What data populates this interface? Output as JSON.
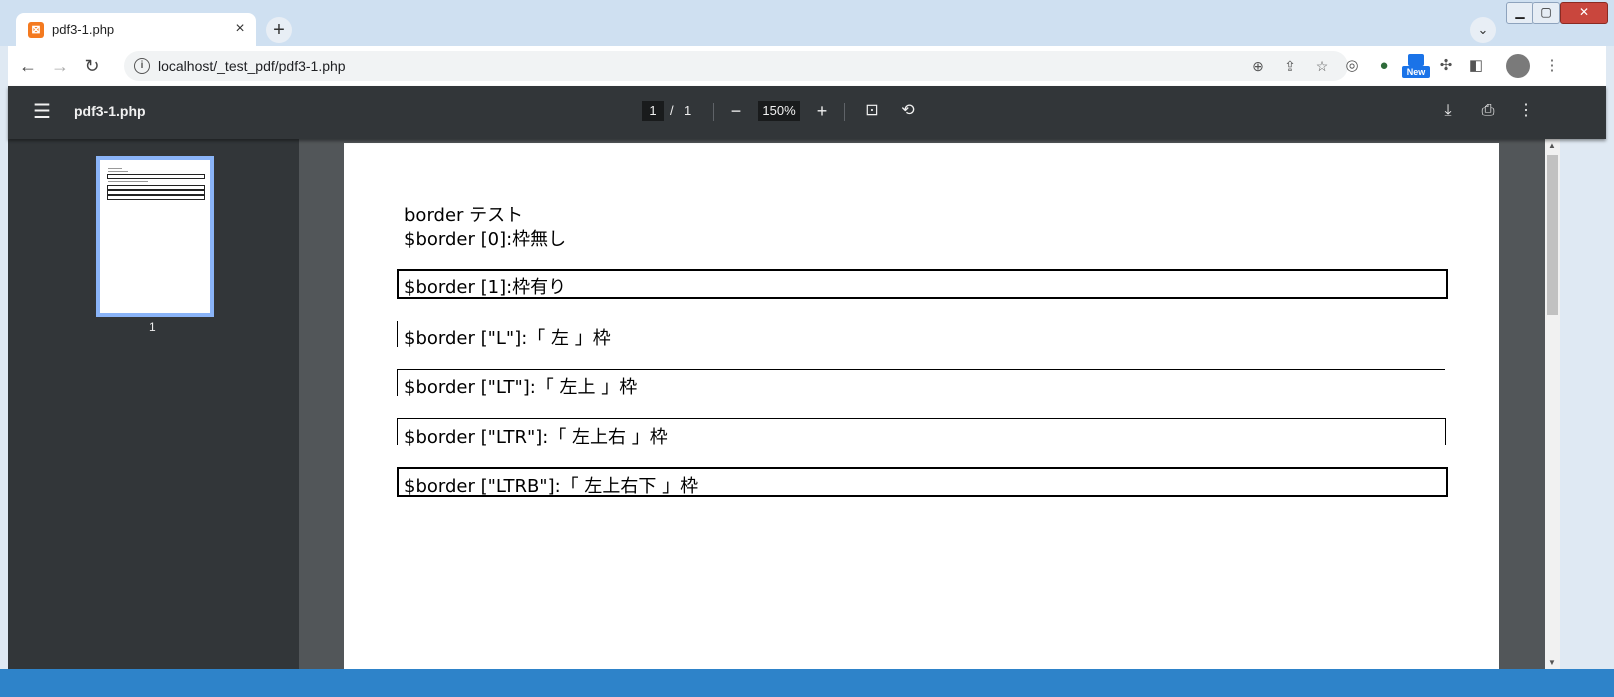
{
  "browser": {
    "tab_title": "pdf3-1.php",
    "tab_favicon": "xampp-icon",
    "new_tab": "+",
    "url": "localhost/_test_pdf/pdf3-1.php",
    "new_badge": "New"
  },
  "pdf": {
    "file_name": "pdf3-1.php",
    "page_current": "1",
    "page_sep": "/",
    "page_total": "1",
    "zoom": "150%",
    "thumbnail_label": "1"
  },
  "document": {
    "title_line": "border テスト",
    "lines": [
      "$border [0]:枠無し",
      "$border [1]:枠有り",
      "$border [\"L\"]:「 左 」枠",
      "$border [\"LT\"]:「 左上 」枠",
      "$border [\"LTR\"]:「 左上右 」枠",
      "$border [\"LTRB\"]:「 左上右下 」枠"
    ]
  },
  "colors": {
    "pdf_toolbar": "#323639",
    "pdf_background": "#525659",
    "thumbnail_highlight": "#8ab4f8"
  }
}
